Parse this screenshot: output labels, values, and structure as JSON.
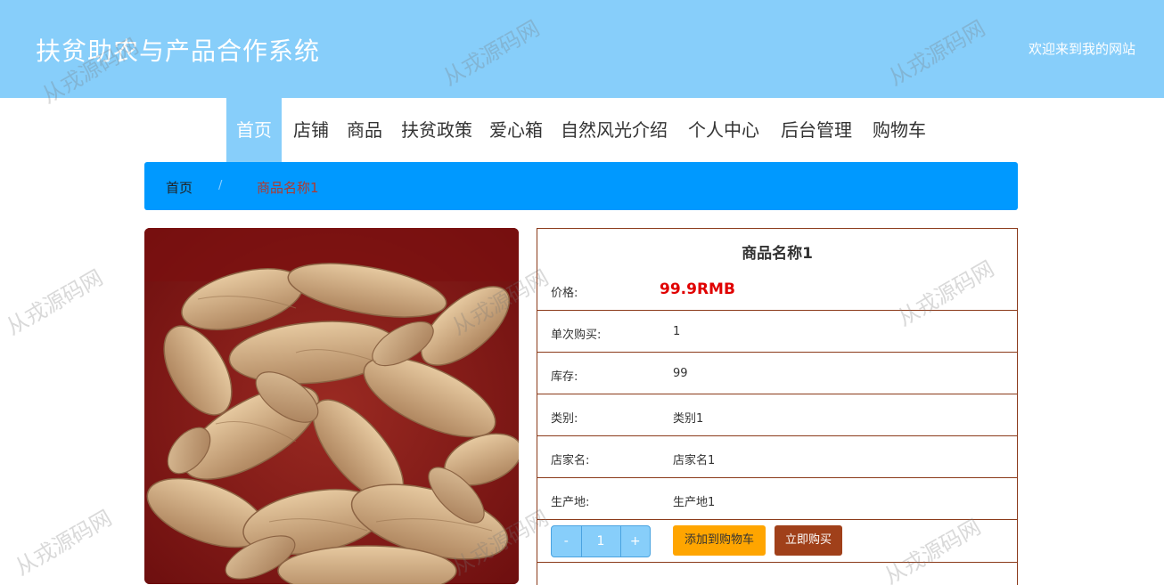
{
  "header": {
    "site_title": "扶贫助农与产品合作系统",
    "welcome": "欢迎来到我的网站",
    "bg_color": "#87cefa"
  },
  "nav": {
    "items": [
      {
        "label": "首页",
        "active": true
      },
      {
        "label": "店铺"
      },
      {
        "label": "商品"
      },
      {
        "label": "扶贫政策"
      },
      {
        "label": "爱心箱"
      },
      {
        "label": "自然风光介绍"
      },
      {
        "label": "个人中心"
      },
      {
        "label": "后台管理"
      },
      {
        "label": "购物车"
      }
    ]
  },
  "breadcrumb": {
    "home": "首页",
    "separator": "/",
    "current": "商品名称1",
    "bg_color": "#0099ff"
  },
  "product": {
    "name": "商品名称1",
    "image_icon": "ginger-product-photo",
    "price_label": "价格:",
    "price_value": "99.9RMB",
    "rows": [
      {
        "label": "单次购买:",
        "value": "1"
      },
      {
        "label": "库存:",
        "value": "99"
      },
      {
        "label": "类别:",
        "value": "类别1"
      },
      {
        "label": "店家名:",
        "value": "店家名1"
      },
      {
        "label": "生产地:",
        "value": "生产地1"
      }
    ],
    "quantity": {
      "minus": "-",
      "value": "1",
      "plus": "+"
    },
    "add_to_cart": "添加到购物车",
    "buy_now": "立即购买"
  },
  "watermark": "从戎源码网"
}
